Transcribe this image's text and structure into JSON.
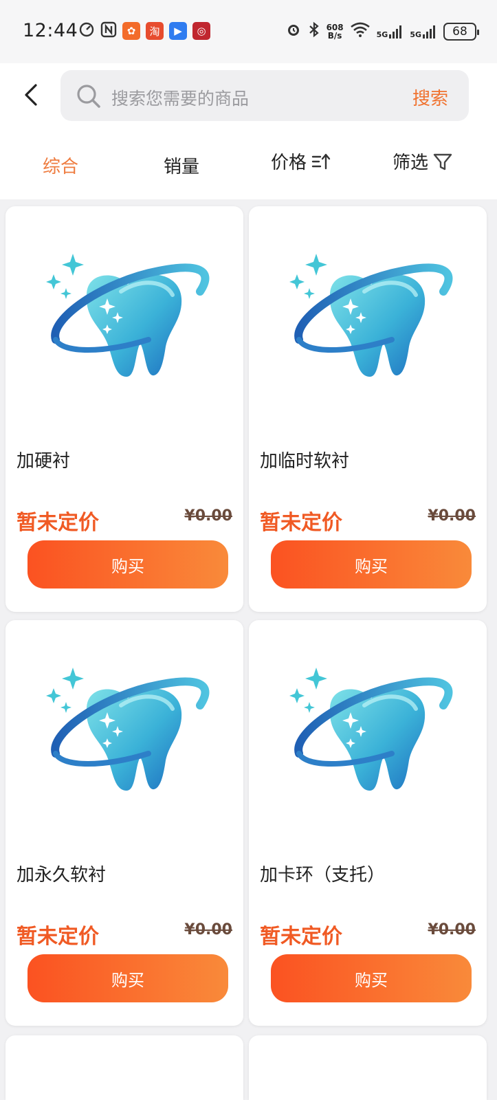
{
  "status_bar": {
    "time": "12:44",
    "net_speed_value": "608",
    "net_speed_unit": "B/s",
    "signal_1": "5G",
    "signal_2": "5G",
    "battery": "68"
  },
  "search": {
    "placeholder": "搜索您需要的商品",
    "button_label": "搜索"
  },
  "sort_tabs": [
    {
      "label": "综合",
      "active": true
    },
    {
      "label": "销量",
      "active": false
    },
    {
      "label": "价格",
      "active": false
    },
    {
      "label": "筛选",
      "active": false
    }
  ],
  "products": [
    {
      "name": "加硬衬",
      "price": "暂未定价",
      "original_price": "¥0.00",
      "buy_label": "购买"
    },
    {
      "name": "加临时软衬",
      "price": "暂未定价",
      "original_price": "¥0.00",
      "buy_label": "购买"
    },
    {
      "name": "加永久软衬",
      "price": "暂未定价",
      "original_price": "¥0.00",
      "buy_label": "购买"
    },
    {
      "name": "加卡环（支托）",
      "price": "暂未定价",
      "original_price": "¥0.00",
      "buy_label": "购买"
    }
  ],
  "colors": {
    "accent": "#f0722f",
    "price": "#f05a24",
    "buy_gradient_start": "#fb5221",
    "buy_gradient_end": "#f98a3a"
  }
}
